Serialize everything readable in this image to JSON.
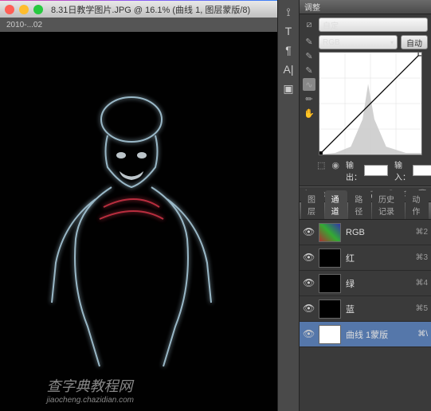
{
  "window": {
    "title": "8.31日教学图片.JPG @ 16.1% (曲线 1, 图层蒙版/8)",
    "tab_text": "2010-...02"
  },
  "curves": {
    "panel_title": "调整",
    "preset": "自定",
    "channel": "RGB",
    "auto": "自动",
    "output_label": "输出：",
    "input_label": "输入："
  },
  "channels": {
    "tabs": [
      "图层",
      "通道",
      "路径",
      "历史记录",
      "动作"
    ],
    "active_tab": 1,
    "rows": [
      {
        "name": "RGB",
        "shortcut": "⌘2",
        "thumb": "rgb"
      },
      {
        "name": "红",
        "shortcut": "⌘3",
        "thumb": "dark"
      },
      {
        "name": "绿",
        "shortcut": "⌘4",
        "thumb": "dark"
      },
      {
        "name": "蓝",
        "shortcut": "⌘5",
        "thumb": "dark"
      },
      {
        "name": "曲线 1蒙版",
        "shortcut": "⌘\\",
        "thumb": "white",
        "selected": true
      }
    ]
  },
  "watermark": "查字典教程网",
  "watermark_sub": "jiaocheng.chazidian.com"
}
